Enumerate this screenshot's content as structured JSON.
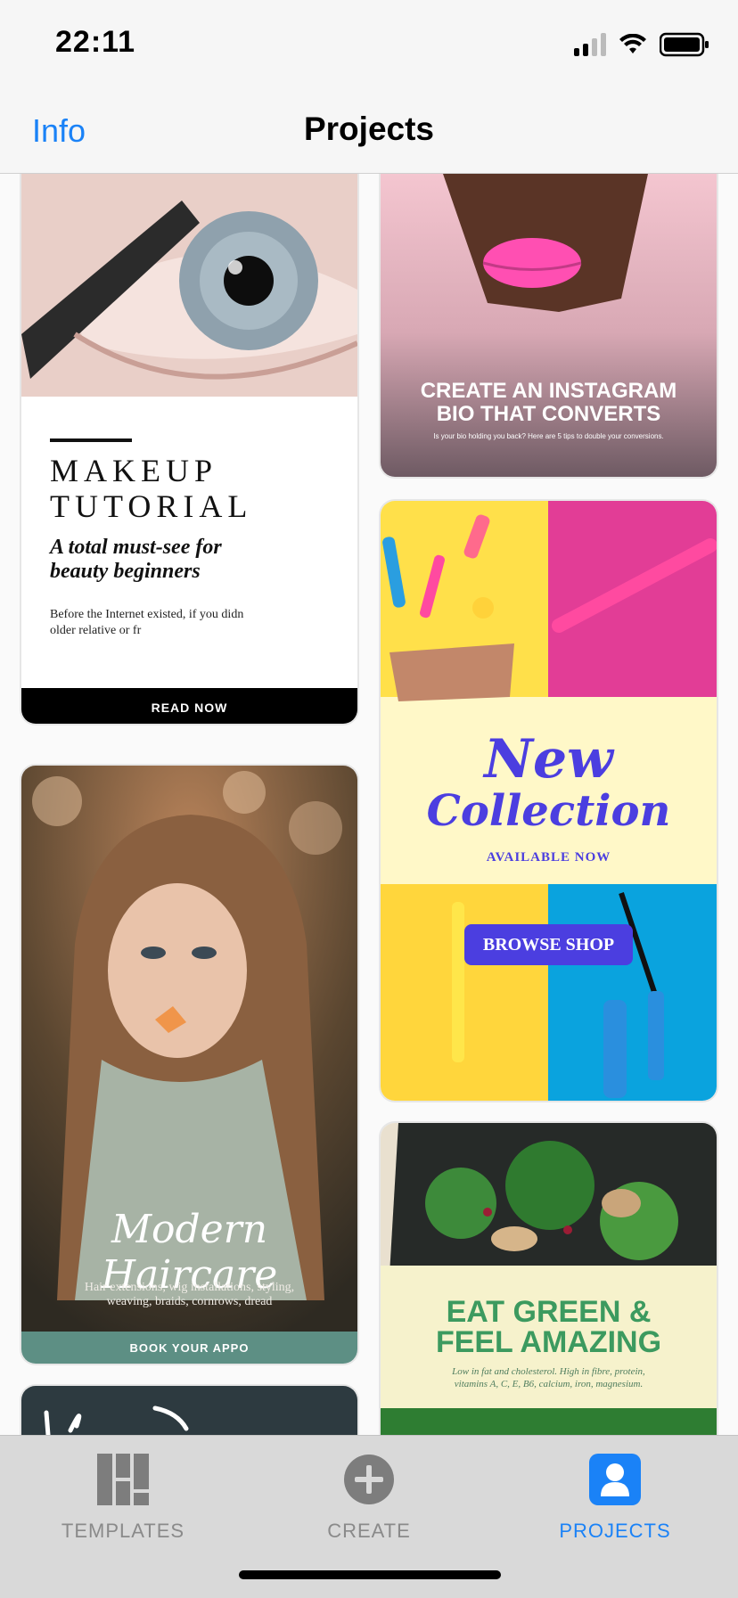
{
  "status": {
    "time": "22:11"
  },
  "nav": {
    "left": "Info",
    "title": "Projects"
  },
  "cards": {
    "makeup": {
      "title1": "MAKEUP",
      "title2": "TUTORIAL",
      "subtitle1": "A total must-see for",
      "subtitle2": "beauty beginners",
      "body1": "Before the Internet existed, if you didn",
      "body2": "older relative or fr",
      "cta": "READ NOW"
    },
    "instagram": {
      "title1": "CREATE AN INSTAGRAM",
      "title2": "BIO THAT CONVERTS",
      "body": "Is your bio holding you back? Here are 5 tips to double your conversions."
    },
    "collection": {
      "title1": "New",
      "title2": "Collection",
      "sub": "AVAILABLE NOW",
      "cta": "BROWSE SHOP"
    },
    "haircare": {
      "title": "Modern Haircare",
      "body1": "Hair extensions, wig installations, styling,",
      "body2": "weaving, braids, cornrows, dread",
      "cta": "BOOK YOUR APPO"
    },
    "green": {
      "title1": "EAT GREEN &",
      "title2": "FEEL AMAZING",
      "body1": "Low in fat and cholesterol. High in fibre, protein,",
      "body2": "vitamins A, C, E, B6, calcium, iron, magnesium."
    }
  },
  "tabs": [
    {
      "label": "TEMPLATES",
      "icon": "templates-icon",
      "color": "#8a8a8a"
    },
    {
      "label": "CREATE",
      "icon": "plus-circle-icon",
      "color": "#8a8a8a"
    },
    {
      "label": "PROJECTS",
      "icon": "person-icon",
      "color": "#1a82f7"
    }
  ],
  "colors": {
    "accent": "#1a82f7",
    "purple": "#4b3ee0",
    "green": "#3c9a5f"
  }
}
